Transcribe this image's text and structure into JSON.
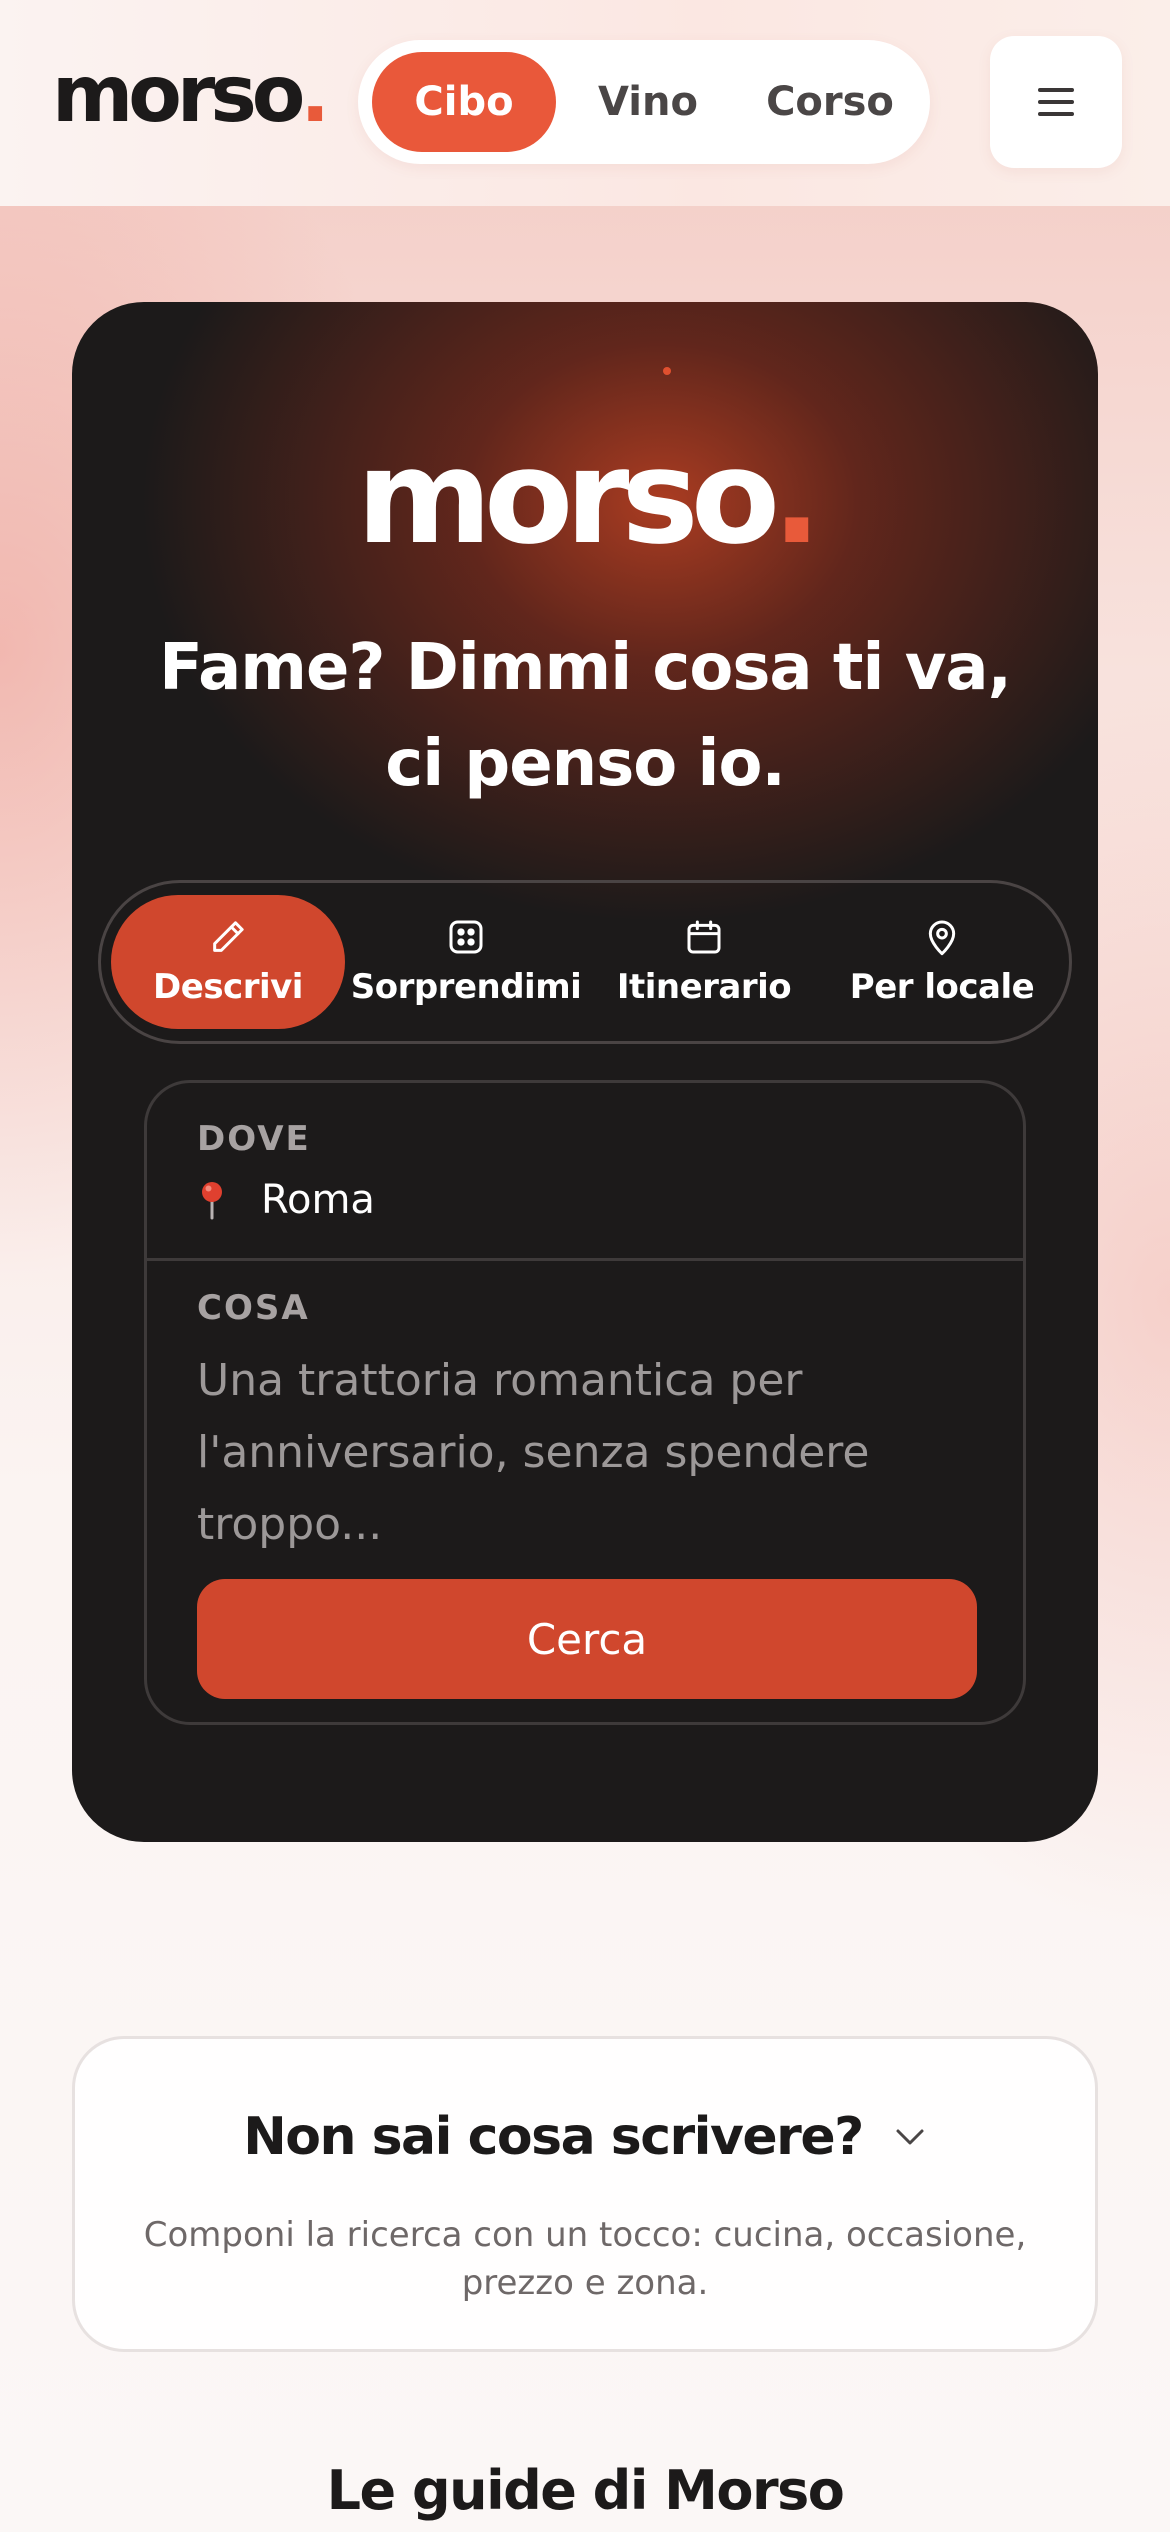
{
  "header": {
    "logo_text": "morso",
    "logo_dot": ".",
    "nav_tabs": [
      {
        "label": "Cibo",
        "active": true
      },
      {
        "label": "Vino",
        "active": false
      },
      {
        "label": "Corso",
        "active": false
      }
    ],
    "menu_icon": "hamburger-menu-icon"
  },
  "hero": {
    "logo_text": "morso",
    "logo_dot": ".",
    "title": "Fame? Dimmi cosa ti va, ci penso io.",
    "modes": [
      {
        "label": "Descrivi",
        "icon": "pencil-icon",
        "active": true
      },
      {
        "label": "Sorprendimi",
        "icon": "dice-icon",
        "active": false
      },
      {
        "label": "Itinerario",
        "icon": "calendar-icon",
        "active": false
      },
      {
        "label": "Per locale",
        "icon": "map-pin-icon",
        "active": false
      }
    ],
    "form": {
      "dove_label": "DOVE",
      "dove_value": "Roma",
      "dove_icon": "red-pushpin-icon",
      "cosa_label": "COSA",
      "cosa_value": "",
      "cosa_placeholder": "Una trattoria romantica per l'anniversario, senza spendere troppo...",
      "search_label": "Cerca"
    }
  },
  "help": {
    "title": "Non sai cosa scrivere?",
    "description": "Componi la ricerca con un tocco: cucina, occasione, prezzo e zona.",
    "chevron_icon": "chevron-down-icon"
  },
  "guides": {
    "title": "Le guide di Morso"
  },
  "colors": {
    "accent": "#e9583a",
    "accent_dark": "#d0472d",
    "card_bg": "#1c1a1a",
    "text_dark": "#1c1a1a"
  }
}
